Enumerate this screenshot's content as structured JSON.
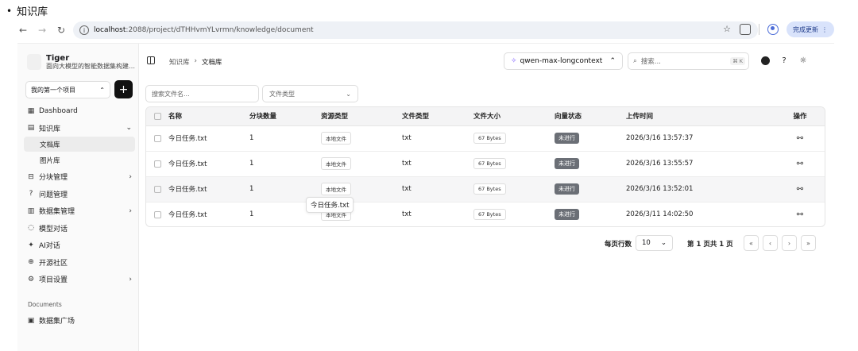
{
  "doc_heading": "知识库",
  "browser": {
    "url_host": "localhost",
    "url_path": ":2088/project/dTHHvmYLvrmn/knowledge/document",
    "update_label": "完成更新"
  },
  "sidebar": {
    "brand_name": "Tiger",
    "brand_sub": "面向大模型的智能数据集构建…",
    "project": "我的第一个项目",
    "items": [
      {
        "label": "Dashboard"
      },
      {
        "label": "知识库"
      },
      {
        "label": "分块管理"
      },
      {
        "label": "问题管理"
      },
      {
        "label": "数据集管理"
      },
      {
        "label": "模型对话"
      },
      {
        "label": "AI对话"
      },
      {
        "label": "开源社区"
      },
      {
        "label": "项目设置"
      }
    ],
    "sub_items": [
      "文档库",
      "图片库"
    ],
    "section_label": "Documents",
    "bottom_items": [
      {
        "label": "数据集广场"
      }
    ]
  },
  "topbar": {
    "crumb_root": "知识库",
    "crumb_current": "文档库",
    "model": "qwen-max-longcontext",
    "search_placeholder": "搜索...",
    "search_shortcut": "⌘ K"
  },
  "filters": {
    "name_placeholder": "搜索文件名...",
    "type_placeholder": "文件类型"
  },
  "table": {
    "headers": [
      "名称",
      "分块数量",
      "资源类型",
      "文件类型",
      "文件大小",
      "向量状态",
      "上传时间",
      "操作"
    ],
    "rows": [
      {
        "name": "今日任务.txt",
        "chunks": "1",
        "source": "本地文件",
        "type": "txt",
        "size": "67 Bytes",
        "status": "未进行",
        "time": "2026/3/16 13:57:37"
      },
      {
        "name": "今日任务.txt",
        "chunks": "1",
        "source": "本地文件",
        "type": "txt",
        "size": "67 Bytes",
        "status": "未进行",
        "time": "2026/3/16 13:55:57"
      },
      {
        "name": "今日任务.txt",
        "chunks": "1",
        "source": "本地文件",
        "type": "txt",
        "size": "67 Bytes",
        "status": "未进行",
        "time": "2026/3/16 13:52:01"
      },
      {
        "name": "今日任务.txt",
        "chunks": "1",
        "source": "本地文件",
        "type": "txt",
        "size": "67 Bytes",
        "status": "未进行",
        "time": "2026/3/11 14:02:50"
      }
    ],
    "tooltip": "今日任务.txt"
  },
  "pagination": {
    "rows_label": "每页行数",
    "page_size": "10",
    "page_info": "第 1 页共 1 页"
  }
}
